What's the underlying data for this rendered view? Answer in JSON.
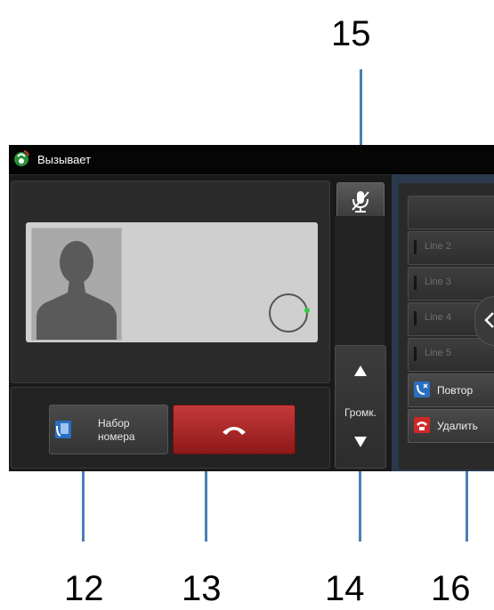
{
  "callouts": {
    "c15": "15",
    "c12": "12",
    "c13": "13",
    "c14": "14",
    "c16": "16"
  },
  "status_bar": {
    "title": "Вызывает",
    "icon": "phone-call-icon"
  },
  "actions": {
    "dial_label_line1": "Набор",
    "dial_label_line2": "номера",
    "end_call_icon": "handset-down-icon",
    "mute_icon": "mic-muted-icon",
    "volume_label": "Громк."
  },
  "lines": [
    {
      "label": ""
    },
    {
      "label": "Line 2"
    },
    {
      "label": "Line 3"
    },
    {
      "label": "Line 4"
    },
    {
      "label": "Line 5"
    }
  ],
  "functions": {
    "redial_label": "Повтор",
    "delete_label": "Удалить"
  },
  "colors": {
    "end_call": "#b22a2a",
    "callout_line": "#4a7fb5",
    "status_led": "#2ecc40"
  }
}
